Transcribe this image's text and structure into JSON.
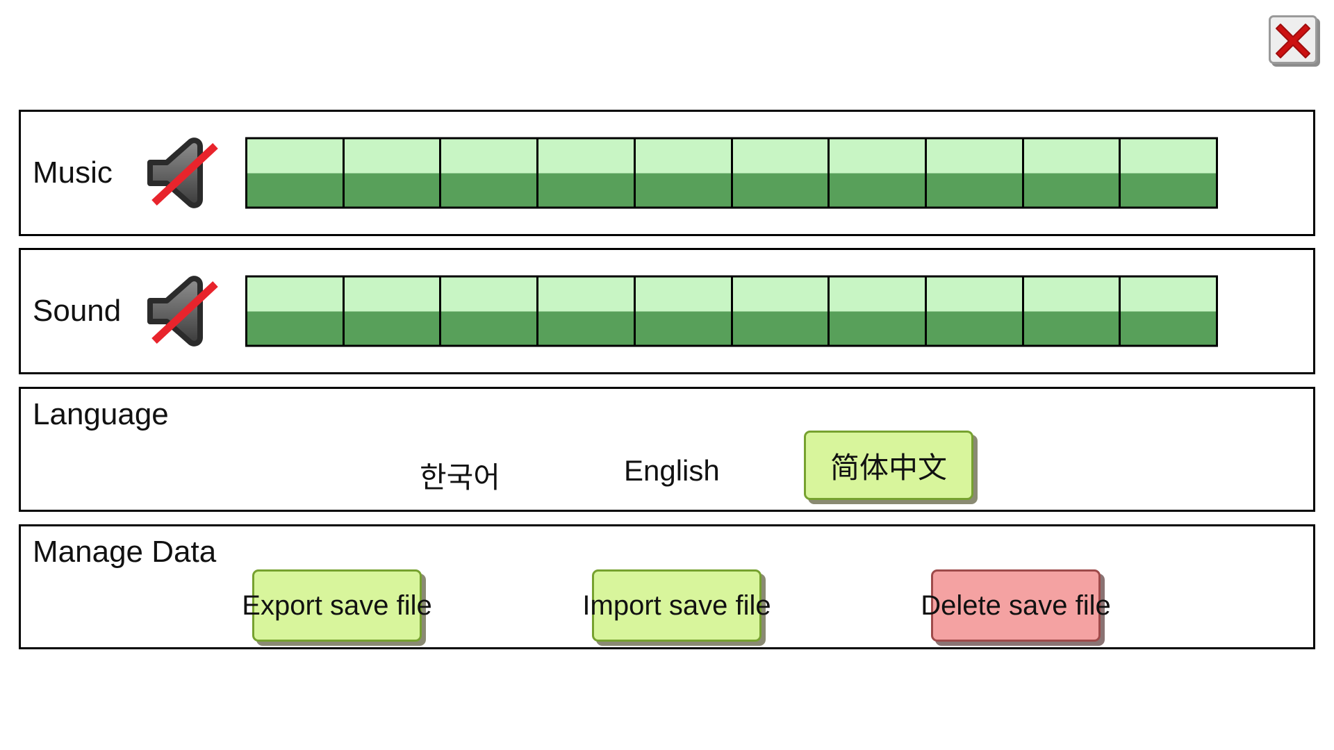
{
  "window": {
    "close_button": {
      "icon": "close-x-icon",
      "label": "X"
    }
  },
  "settings": {
    "music": {
      "label": "Music",
      "icon": "speaker-muted-icon",
      "muted": true,
      "steps": 10,
      "fill_ratio": 0.5
    },
    "sound": {
      "label": "Sound",
      "icon": "speaker-muted-icon",
      "muted": true,
      "steps": 10,
      "fill_ratio": 0.5
    },
    "language": {
      "title": "Language",
      "options": [
        "한국어",
        "English",
        "简体中文"
      ],
      "selected": "简体中文"
    },
    "manage_data": {
      "title": "Manage Data",
      "buttons": [
        {
          "label": "Export save file",
          "style": "green"
        },
        {
          "label": "Import save file",
          "style": "green"
        },
        {
          "label": "Delete save file",
          "style": "red"
        }
      ]
    }
  },
  "colors": {
    "bar_empty": "#c8f5c4",
    "bar_fill": "#58a05a",
    "button_green": "#d8f59c",
    "button_green_border": "#76a12f",
    "button_red": "#f4a2a2",
    "button_red_border": "#9e4a4a",
    "panel_border": "#000000",
    "close_x": "#cc1111"
  }
}
